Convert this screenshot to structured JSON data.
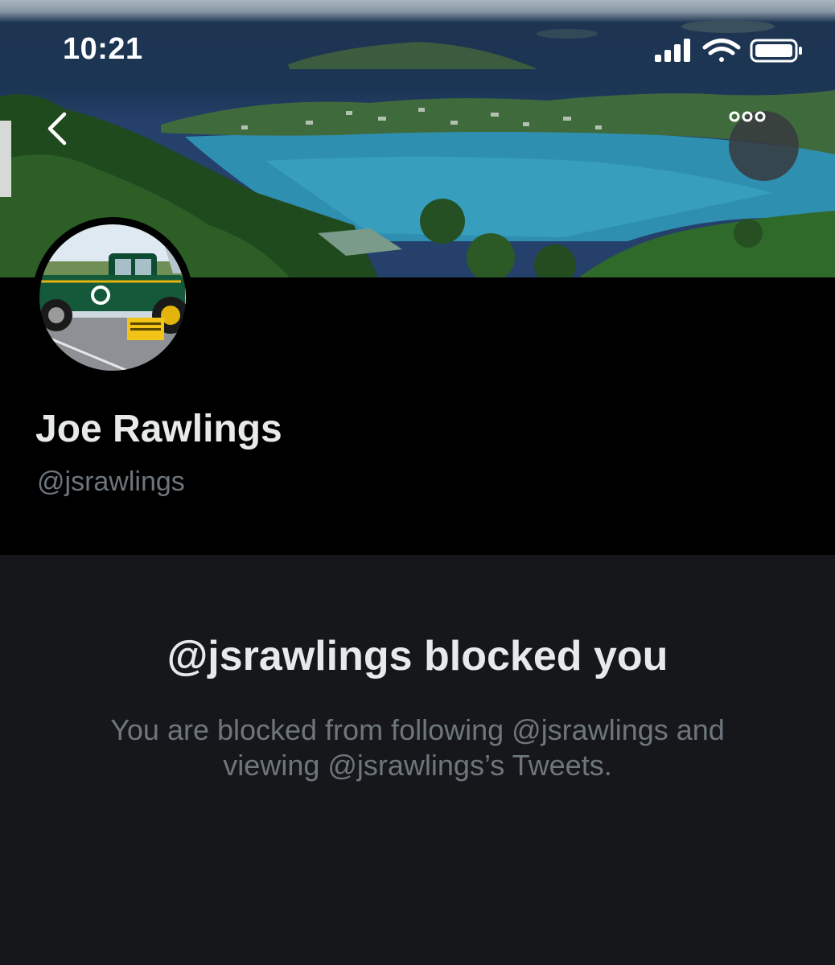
{
  "status_bar": {
    "time": "10:21"
  },
  "icons": {
    "back": "chevron-left-icon",
    "more": "more-horizontal-icon",
    "signal": "cellular-signal-icon",
    "wifi": "wifi-icon",
    "battery": "battery-icon"
  },
  "profile": {
    "name": "Joe Rawlings",
    "handle": "@jsrawlings"
  },
  "blocked": {
    "title": "@jsrawlings blocked you",
    "message": "You are blocked from following @jsrawlings and viewing @jsrawlings’s Tweets."
  },
  "colors": {
    "background": "#000000",
    "panel": "#16171a",
    "primary_text": "#e7e9ea",
    "secondary_text": "#6e767d"
  }
}
